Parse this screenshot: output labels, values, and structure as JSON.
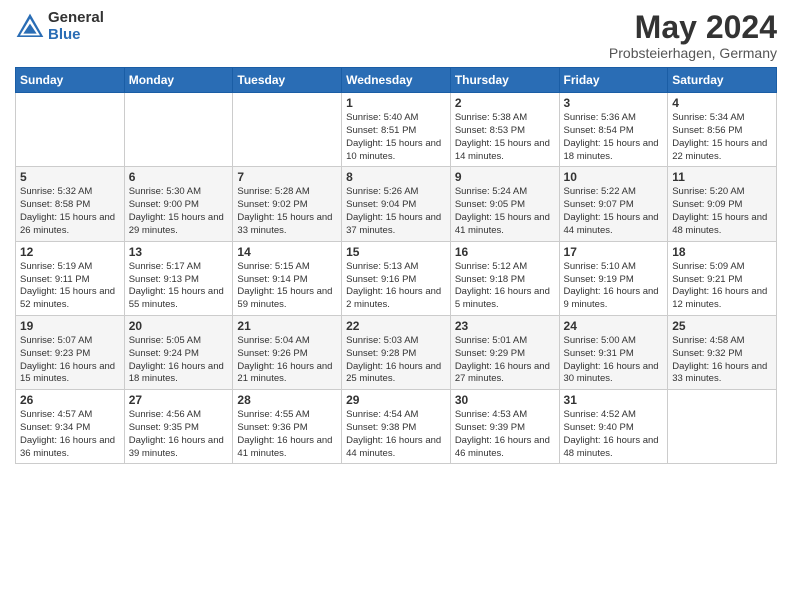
{
  "logo": {
    "general": "General",
    "blue": "Blue"
  },
  "header": {
    "month": "May 2024",
    "location": "Probsteierhagen, Germany"
  },
  "weekdays": [
    "Sunday",
    "Monday",
    "Tuesday",
    "Wednesday",
    "Thursday",
    "Friday",
    "Saturday"
  ],
  "weeks": [
    [
      {
        "day": "",
        "info": ""
      },
      {
        "day": "",
        "info": ""
      },
      {
        "day": "",
        "info": ""
      },
      {
        "day": "1",
        "info": "Sunrise: 5:40 AM\nSunset: 8:51 PM\nDaylight: 15 hours\nand 10 minutes."
      },
      {
        "day": "2",
        "info": "Sunrise: 5:38 AM\nSunset: 8:53 PM\nDaylight: 15 hours\nand 14 minutes."
      },
      {
        "day": "3",
        "info": "Sunrise: 5:36 AM\nSunset: 8:54 PM\nDaylight: 15 hours\nand 18 minutes."
      },
      {
        "day": "4",
        "info": "Sunrise: 5:34 AM\nSunset: 8:56 PM\nDaylight: 15 hours\nand 22 minutes."
      }
    ],
    [
      {
        "day": "5",
        "info": "Sunrise: 5:32 AM\nSunset: 8:58 PM\nDaylight: 15 hours\nand 26 minutes."
      },
      {
        "day": "6",
        "info": "Sunrise: 5:30 AM\nSunset: 9:00 PM\nDaylight: 15 hours\nand 29 minutes."
      },
      {
        "day": "7",
        "info": "Sunrise: 5:28 AM\nSunset: 9:02 PM\nDaylight: 15 hours\nand 33 minutes."
      },
      {
        "day": "8",
        "info": "Sunrise: 5:26 AM\nSunset: 9:04 PM\nDaylight: 15 hours\nand 37 minutes."
      },
      {
        "day": "9",
        "info": "Sunrise: 5:24 AM\nSunset: 9:05 PM\nDaylight: 15 hours\nand 41 minutes."
      },
      {
        "day": "10",
        "info": "Sunrise: 5:22 AM\nSunset: 9:07 PM\nDaylight: 15 hours\nand 44 minutes."
      },
      {
        "day": "11",
        "info": "Sunrise: 5:20 AM\nSunset: 9:09 PM\nDaylight: 15 hours\nand 48 minutes."
      }
    ],
    [
      {
        "day": "12",
        "info": "Sunrise: 5:19 AM\nSunset: 9:11 PM\nDaylight: 15 hours\nand 52 minutes."
      },
      {
        "day": "13",
        "info": "Sunrise: 5:17 AM\nSunset: 9:13 PM\nDaylight: 15 hours\nand 55 minutes."
      },
      {
        "day": "14",
        "info": "Sunrise: 5:15 AM\nSunset: 9:14 PM\nDaylight: 15 hours\nand 59 minutes."
      },
      {
        "day": "15",
        "info": "Sunrise: 5:13 AM\nSunset: 9:16 PM\nDaylight: 16 hours\nand 2 minutes."
      },
      {
        "day": "16",
        "info": "Sunrise: 5:12 AM\nSunset: 9:18 PM\nDaylight: 16 hours\nand 5 minutes."
      },
      {
        "day": "17",
        "info": "Sunrise: 5:10 AM\nSunset: 9:19 PM\nDaylight: 16 hours\nand 9 minutes."
      },
      {
        "day": "18",
        "info": "Sunrise: 5:09 AM\nSunset: 9:21 PM\nDaylight: 16 hours\nand 12 minutes."
      }
    ],
    [
      {
        "day": "19",
        "info": "Sunrise: 5:07 AM\nSunset: 9:23 PM\nDaylight: 16 hours\nand 15 minutes."
      },
      {
        "day": "20",
        "info": "Sunrise: 5:05 AM\nSunset: 9:24 PM\nDaylight: 16 hours\nand 18 minutes."
      },
      {
        "day": "21",
        "info": "Sunrise: 5:04 AM\nSunset: 9:26 PM\nDaylight: 16 hours\nand 21 minutes."
      },
      {
        "day": "22",
        "info": "Sunrise: 5:03 AM\nSunset: 9:28 PM\nDaylight: 16 hours\nand 25 minutes."
      },
      {
        "day": "23",
        "info": "Sunrise: 5:01 AM\nSunset: 9:29 PM\nDaylight: 16 hours\nand 27 minutes."
      },
      {
        "day": "24",
        "info": "Sunrise: 5:00 AM\nSunset: 9:31 PM\nDaylight: 16 hours\nand 30 minutes."
      },
      {
        "day": "25",
        "info": "Sunrise: 4:58 AM\nSunset: 9:32 PM\nDaylight: 16 hours\nand 33 minutes."
      }
    ],
    [
      {
        "day": "26",
        "info": "Sunrise: 4:57 AM\nSunset: 9:34 PM\nDaylight: 16 hours\nand 36 minutes."
      },
      {
        "day": "27",
        "info": "Sunrise: 4:56 AM\nSunset: 9:35 PM\nDaylight: 16 hours\nand 39 minutes."
      },
      {
        "day": "28",
        "info": "Sunrise: 4:55 AM\nSunset: 9:36 PM\nDaylight: 16 hours\nand 41 minutes."
      },
      {
        "day": "29",
        "info": "Sunrise: 4:54 AM\nSunset: 9:38 PM\nDaylight: 16 hours\nand 44 minutes."
      },
      {
        "day": "30",
        "info": "Sunrise: 4:53 AM\nSunset: 9:39 PM\nDaylight: 16 hours\nand 46 minutes."
      },
      {
        "day": "31",
        "info": "Sunrise: 4:52 AM\nSunset: 9:40 PM\nDaylight: 16 hours\nand 48 minutes."
      },
      {
        "day": "",
        "info": ""
      }
    ]
  ]
}
